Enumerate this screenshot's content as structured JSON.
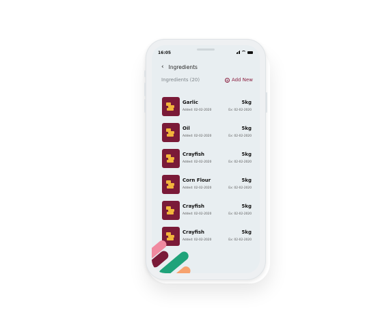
{
  "status_bar": {
    "time": "16:05"
  },
  "header": {
    "title": "Ingredients"
  },
  "list_header": {
    "count_label": "Ingredients (20)",
    "add_label": "Add New"
  },
  "items": [
    {
      "name": "Garlic",
      "qty": "5kg",
      "added": "Added: 02-02-2020",
      "expires": "Ex: 02-02-2020"
    },
    {
      "name": "Oil",
      "qty": "5kg",
      "added": "Added: 02-02-2020",
      "expires": "Ex: 02-02-2020"
    },
    {
      "name": "Crayfish",
      "qty": "5kg",
      "added": "Added: 02-02-2020",
      "expires": "Ex: 02-02-2020"
    },
    {
      "name": "Corn Flour",
      "qty": "5kg",
      "added": "Added: 02-02-2020",
      "expires": "Ex: 02-02-2020"
    },
    {
      "name": "Crayfish",
      "qty": "5kg",
      "added": "Added: 02-02-2020",
      "expires": "Ex: 02-02-2020"
    },
    {
      "name": "Crayfish",
      "qty": "5kg",
      "added": "Added: 02-02-2020",
      "expires": "Ex: 02-02-2020"
    }
  ],
  "colors": {
    "brand": "#8b1e3f",
    "thumb": "#7a1a38",
    "accent": "#f1b43c",
    "teal": "#1fa37a",
    "salmon": "#f7a26e",
    "pink": "#f08aa0"
  },
  "icons": {
    "back": "chevron-left-icon",
    "add": "plus-circle-icon",
    "item": "ingredient-box-icon"
  }
}
